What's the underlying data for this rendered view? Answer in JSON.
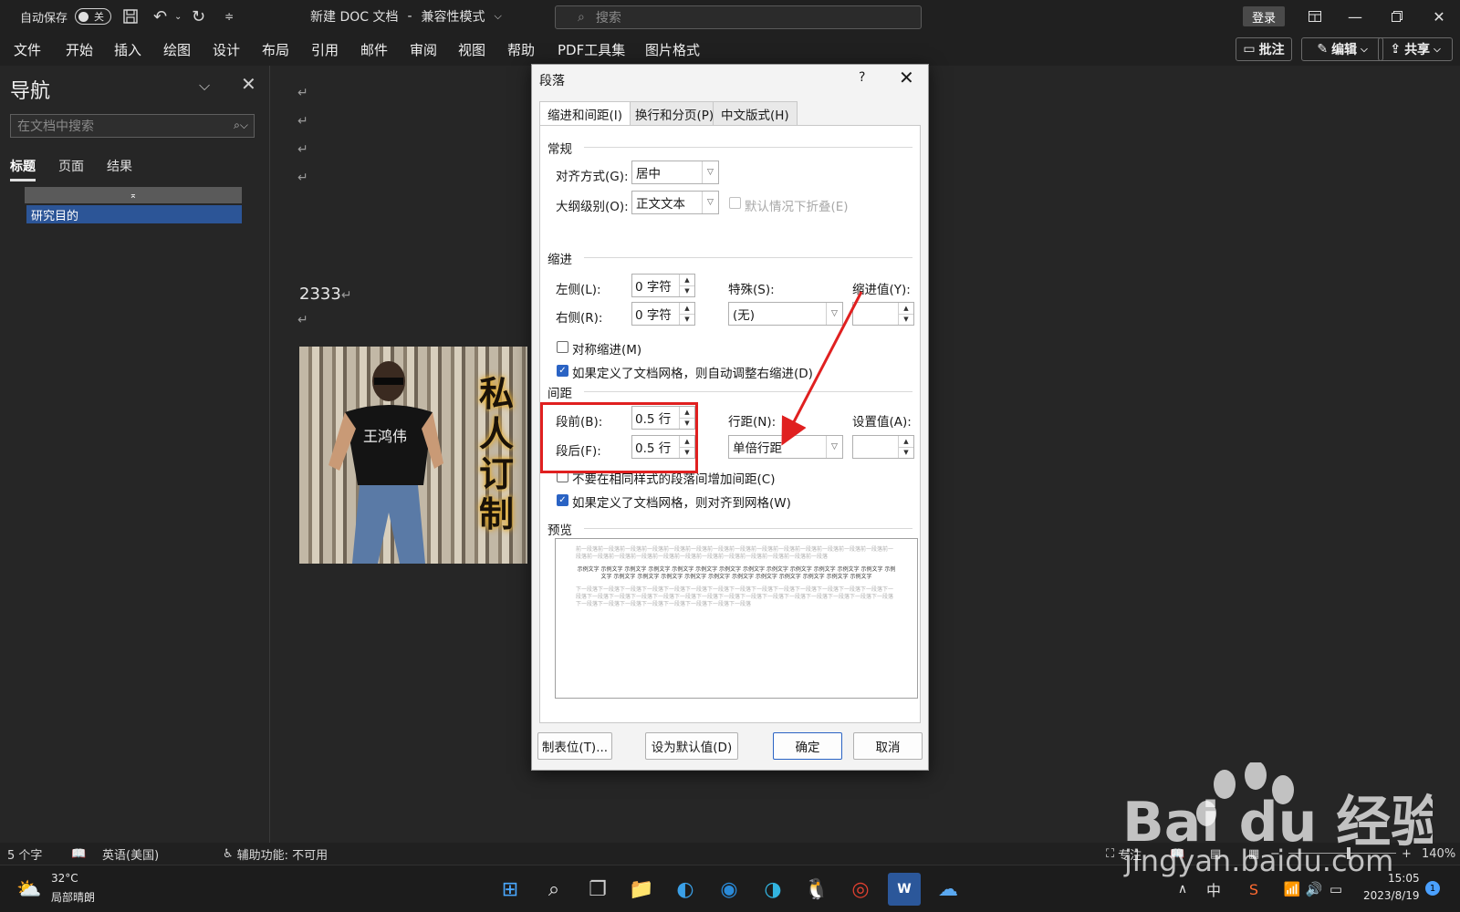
{
  "titlebar": {
    "autosave_label": "自动保存",
    "autosave_state": "关",
    "doc_title": "新建 DOC 文档",
    "separator": "-",
    "mode": "兼容性模式",
    "search_placeholder": "搜索",
    "login": "登录"
  },
  "menu": [
    "文件",
    "开始",
    "插入",
    "绘图",
    "设计",
    "布局",
    "引用",
    "邮件",
    "审阅",
    "视图",
    "帮助",
    "PDF工具集",
    "图片格式"
  ],
  "ribbon_buttons": {
    "comments": "批注",
    "editing": "编辑",
    "share": "共享"
  },
  "nav": {
    "title": "导航",
    "search_placeholder": "在文档中搜索",
    "tabs": [
      "标题",
      "页面",
      "结果"
    ],
    "collapse_glyph": "⌅",
    "headings": [
      "研究目的"
    ]
  },
  "document": {
    "paragraph_mark": "↵",
    "text_line": "2333"
  },
  "photo": {
    "calligraphy": "私人订制",
    "shirt_text": "王鸿伟"
  },
  "dialog": {
    "title": "段落",
    "help": "?",
    "tabs": [
      "缩进和间距(I)",
      "换行和分页(P)",
      "中文版式(H)"
    ],
    "general": {
      "title": "常规",
      "alignment_label": "对齐方式(G):",
      "alignment_value": "居中",
      "outline_label": "大纲级别(O):",
      "outline_value": "正文文本",
      "collapse_label": "默认情况下折叠(E)"
    },
    "indent": {
      "title": "缩进",
      "left_label": "左侧(L):",
      "left_value": "0 字符",
      "right_label": "右侧(R):",
      "right_value": "0 字符",
      "special_label": "特殊(S):",
      "special_value": "(无)",
      "indent_by_label": "缩进值(Y):",
      "mirror_label": "对称缩进(M)",
      "grid_label": "如果定义了文档网格，则自动调整右缩进(D)"
    },
    "spacing": {
      "title": "间距",
      "before_label": "段前(B):",
      "before_value": "0.5 行",
      "after_label": "段后(F):",
      "after_value": "0.5 行",
      "line_label": "行距(N):",
      "line_value": "单倍行距",
      "at_label": "设置值(A):",
      "no_space_label": "不要在相同样式的段落间增加间距(C)",
      "snap_label": "如果定义了文档网格，则对齐到网格(W)"
    },
    "preview": {
      "title": "预览",
      "before_text": "前一段落前一段落前一段落前一段落前一段落前一段落前一段落前一段落前一段落前一段落前一段落前一段落前一段落前一段落前一段落前一段落前一段落前一段落前一段落前一段落前一段落前一段落前一段落前一段落前一段落前一段落",
      "sample_text": "示例文字 示例文字 示例文字 示例文字 示例文字 示例文字 示例文字 示例文字 示例文字 示例文字 示例文字 示例文字 示例文字 示例文字 示例文字 示例文字 示例文字 示例文字 示例文字 示例文字 示例文字 示例文字 示例文字 示例文字 示例文字",
      "after_text": "下一段落下一段落下一段落下一段落下一段落下一段落下一段落下一段落下一段落下一段落下一段落下一段落下一段落下一段落下一段落下一段落下一段落下一段落下一段落下一段落下一段落下一段落下一段落下一段落下一段落下一段落下一段落下一段落下一段落下一段落下一段落下一段落下一段落下一段落下一段落下一段落下一段落"
    },
    "buttons": {
      "tabs": "制表位(T)...",
      "default": "设为默认值(D)",
      "ok": "确定",
      "cancel": "取消"
    }
  },
  "statusbar": {
    "word_count": "5 个字",
    "language": "英语(美国)",
    "accessibility": "辅助功能: 不可用",
    "focus": "专注",
    "zoom": "140%"
  },
  "taskbar": {
    "temperature": "32°C",
    "weather": "局部晴朗",
    "ime": "中",
    "time": "15:05",
    "date": "2023/8/19",
    "notifications": "1"
  },
  "watermark": {
    "logo": "Bai du 经验",
    "url": "jingyan.baidu.com"
  },
  "colors": {
    "accent": "#2a63c4",
    "annotation": "#e02020",
    "nav_selected": "#2c5597"
  }
}
